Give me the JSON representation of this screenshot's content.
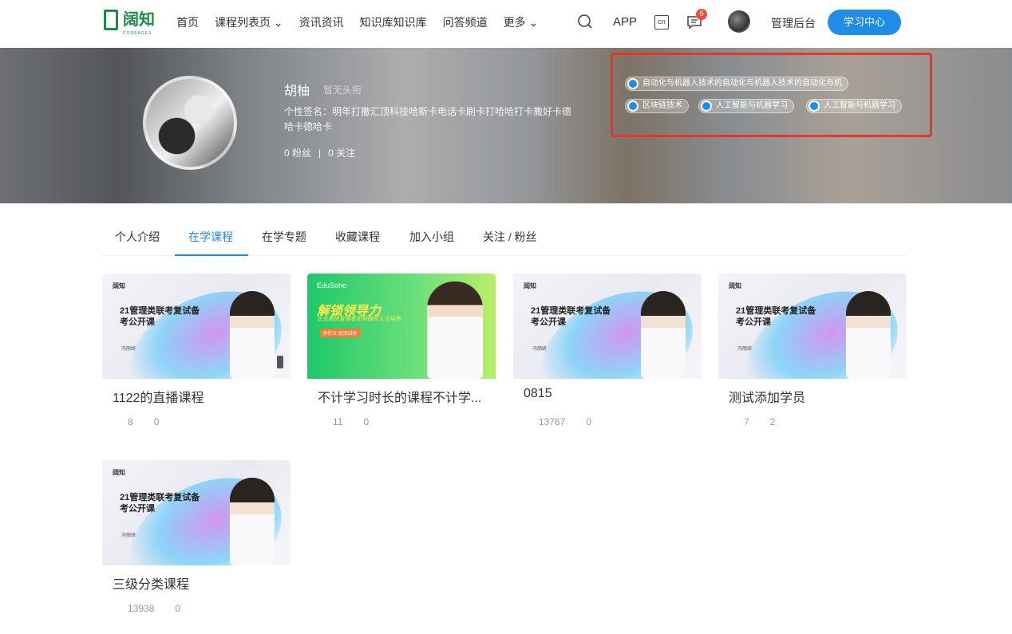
{
  "header": {
    "logo_text": "阔知",
    "logo_sub": "CODEAGES",
    "nav": [
      "首页",
      "课程列表页 ⌄",
      "资讯资讯",
      "知识库知识库",
      "问答频道",
      "更多 ⌄"
    ],
    "app_label": "APP",
    "lang_label": "cn",
    "message_badge": "6",
    "admin_label": "管理后台",
    "learn_center_label": "学习中心",
    "icons": {
      "search": "search-icon",
      "lang": "language-icon",
      "message": "message-icon"
    }
  },
  "profile": {
    "name": "胡柚",
    "title": "暂无头衔",
    "signature": "个性签名：明年打撒汇顶科技哈斯卡电话卡刷卡打哈哈打卡撒好卡德哈卡德哈卡",
    "fans_label": "0 粉丝",
    "separator": "|",
    "following_label": "0 关注",
    "tags": [
      "自动化与机器人技术的自动化与机器人技术的自动化与机",
      "区块链技术",
      "人工智能与机器学习",
      "人工智能与机器学习"
    ]
  },
  "tabs": [
    "个人介绍",
    "在学课程",
    "在学专题",
    "收藏课程",
    "加入小组",
    "关注 / 粉丝"
  ],
  "active_tab": "在学课程",
  "courses": [
    {
      "title": "1122的直播课程",
      "students": "8",
      "reviews": "0",
      "cover": {
        "brand": "阔知",
        "headline": "21管理类联考复试备考公开课",
        "author": "冯丽妍"
      }
    },
    {
      "title": "不计学习时长的课程不计学...",
      "students": "11",
      "reviews": "0",
      "cover": {
        "brand": "EduSoho",
        "headline": "解锁领导力",
        "sub": "企业高级管理者如何做好人才培养",
        "name": "李彩玉 资深讲师"
      }
    },
    {
      "title": "0815",
      "students": "13767",
      "reviews": "0",
      "cover": {
        "brand": "阔知",
        "headline": "21管理类联考复试备考公开课",
        "author": "冯丽妍"
      }
    },
    {
      "title": "测试添加学员",
      "students": "7",
      "reviews": "2",
      "cover": {
        "brand": "阔知",
        "headline": "21管理类联考复试备考公开课",
        "author": "冯丽妍"
      }
    },
    {
      "title": "三级分类课程",
      "students": "13938",
      "reviews": "0",
      "cover": {
        "brand": "阔知",
        "headline": "21管理类联考复试备考公开课",
        "author": "冯丽妍"
      }
    }
  ],
  "colors": {
    "primary": "#1f8ce6",
    "logo_green": "#1d8c47",
    "highlight_box": "#e8342a",
    "badge": "#f04a3a"
  }
}
